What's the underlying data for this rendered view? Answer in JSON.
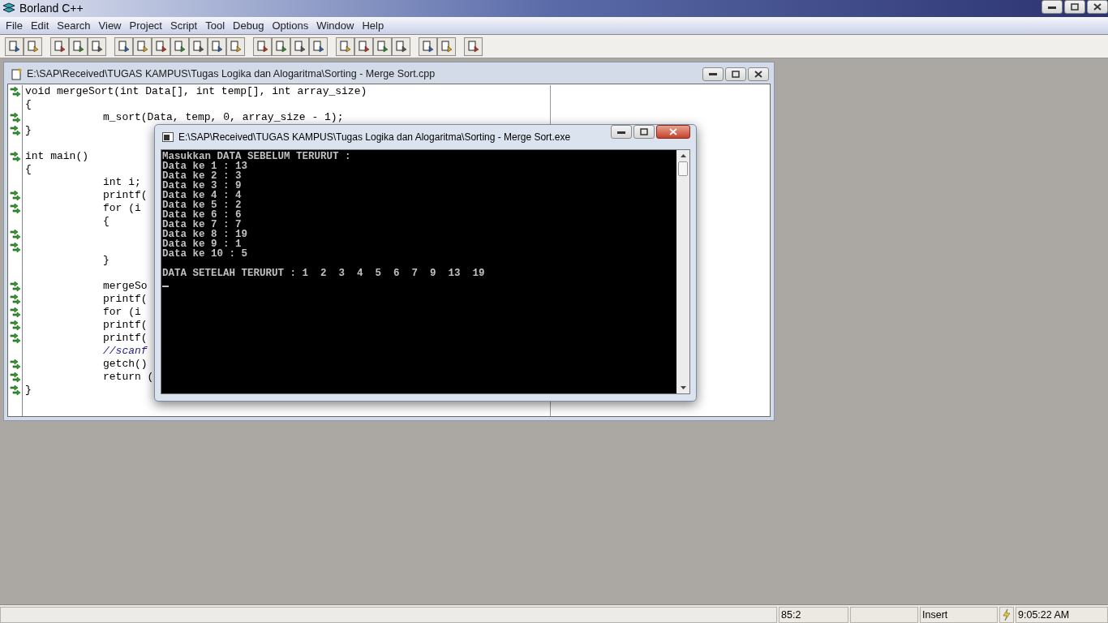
{
  "app_window": {
    "title": "Borland C++"
  },
  "menu": [
    "File",
    "Edit",
    "Search",
    "View",
    "Project",
    "Script",
    "Tool",
    "Debug",
    "Options",
    "Window",
    "Help"
  ],
  "editor": {
    "title": "E:\\SAP\\Received\\TUGAS KAMPUS\\Tugas Logika dan Alogaritma\\Sorting - Merge Sort.cpp",
    "lines": [
      {
        "kind": "top",
        "marker": true,
        "text": "void mergeSort(int Data[], int temp[], int array_size)"
      },
      {
        "kind": "top",
        "marker": false,
        "text": "{"
      },
      {
        "kind": "body",
        "marker": true,
        "text": "m_sort(Data, temp, 0, array_size - 1);"
      },
      {
        "kind": "top",
        "marker": true,
        "text": "}"
      },
      {
        "kind": "top",
        "marker": false
      },
      {
        "kind": "top",
        "marker": true,
        "text": "int main()"
      },
      {
        "kind": "top",
        "marker": false,
        "text": "{"
      },
      {
        "kind": "body",
        "marker": false,
        "text": "int i;"
      },
      {
        "kind": "body",
        "marker": true,
        "text": "printf("
      },
      {
        "kind": "body",
        "marker": true,
        "text": "for (i"
      },
      {
        "kind": "body",
        "marker": false,
        "text": "{"
      },
      {
        "kind": "body",
        "marker": true
      },
      {
        "kind": "body",
        "marker": true
      },
      {
        "kind": "body",
        "marker": false,
        "text": "}"
      },
      {
        "kind": "body",
        "marker": false
      },
      {
        "kind": "body",
        "marker": true,
        "text": "mergeSo"
      },
      {
        "kind": "body",
        "marker": true,
        "text": "printf("
      },
      {
        "kind": "body",
        "marker": true,
        "text": "for (i"
      },
      {
        "kind": "body",
        "marker": true,
        "text": "printf("
      },
      {
        "kind": "body",
        "marker": true,
        "text": "printf("
      },
      {
        "kind": "comment",
        "marker": false,
        "text": "//scanf"
      },
      {
        "kind": "body",
        "marker": true,
        "text": "getch()"
      },
      {
        "kind": "body",
        "marker": true,
        "text": "return ("
      },
      {
        "kind": "top",
        "marker": true,
        "text": "}"
      }
    ]
  },
  "console": {
    "title": "E:\\SAP\\Received\\TUGAS KAMPUS\\Tugas Logika dan Alogaritma\\Sorting - Merge Sort.exe",
    "lines": [
      "Masukkan DATA SEBELUM TERURUT :",
      "Data ke 1 : 13",
      "Data ke 2 : 3",
      "Data ke 3 : 9",
      "Data ke 4 : 4",
      "Data ke 5 : 2",
      "Data ke 6 : 6",
      "Data ke 7 : 7",
      "Data ke 8 : 19",
      "Data ke 9 : 1",
      "Data ke 10 : 5"
    ],
    "result": "DATA SETELAH TERURUT : 1  2  3  4  5  6  7  9  13  19"
  },
  "status_bar": {
    "position": "85:2",
    "mode": "Insert",
    "time": "9:05:22 AM"
  }
}
